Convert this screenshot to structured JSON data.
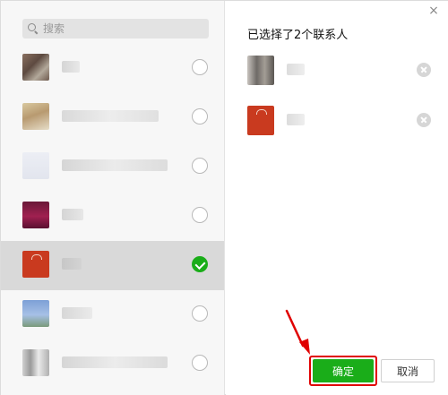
{
  "search": {
    "placeholder": "搜索",
    "icon": "search-icon"
  },
  "contacts": [
    {
      "avatar": "avatar-1",
      "checked": false
    },
    {
      "avatar": "avatar-2",
      "checked": false
    },
    {
      "avatar": "avatar-3",
      "checked": false
    },
    {
      "avatar": "avatar-4",
      "checked": false
    },
    {
      "avatar": "avatar-5",
      "checked": true
    },
    {
      "avatar": "avatar-6",
      "checked": false
    },
    {
      "avatar": "avatar-7",
      "checked": false
    }
  ],
  "selected_panel": {
    "title": "已选择了2个联系人",
    "items": [
      {
        "avatar": "avatar-1"
      },
      {
        "avatar": "avatar-5"
      }
    ]
  },
  "actions": {
    "confirm_label": "确定",
    "cancel_label": "取消"
  },
  "colors": {
    "accent": "#1aad19",
    "highlight": "#e00000",
    "selected_row": "#d9d9d9"
  }
}
